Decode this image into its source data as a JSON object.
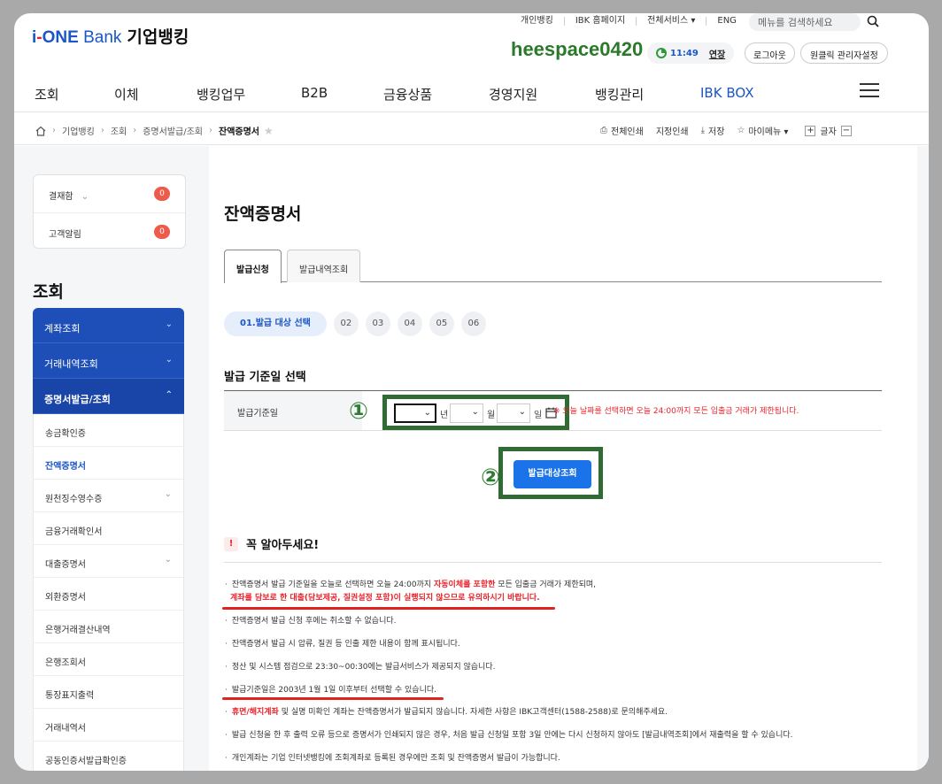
{
  "header": {
    "logo_prefix": "i",
    "logo_dash": "-",
    "logo_one": "ONE",
    "logo_bank": "Bank",
    "logo_kr": "기업뱅킹",
    "util_links": [
      "개인뱅킹",
      "IBK 홈페이지",
      "전체서비스 ▾",
      "ENG"
    ],
    "search_placeholder": "메뉴를 검색하세요",
    "watermark": "heespace0420",
    "session_time": "11:49",
    "extend_label": "연장",
    "logout_label": "로그아웃",
    "oneclick_label": "원클릭 관리자설정"
  },
  "gnb": [
    "조회",
    "이체",
    "뱅킹업무",
    "B2B",
    "금융상품",
    "경영지원",
    "뱅킹관리",
    "IBK BOX"
  ],
  "breadcrumb": [
    "기업뱅킹",
    "조회",
    "증명서발급/조회",
    "잔액증명서"
  ],
  "tools": {
    "print_all": "전체인쇄",
    "print_selected": "지정인쇄",
    "save": "저장",
    "my_menu": "마이메뉴 ▾",
    "font_label": "글자"
  },
  "sidebar": {
    "alarm": [
      {
        "label": "결재함",
        "count": "0"
      },
      {
        "label": "고객알림",
        "count": "0"
      }
    ],
    "title": "조회",
    "groups": [
      {
        "label": "계좌조회"
      },
      {
        "label": "거래내역조회"
      },
      {
        "label": "증명서발급/조회"
      }
    ],
    "subitems": [
      "송금확인증",
      "잔액증명서",
      "원천징수영수증",
      "금융거래확인서",
      "대출증명서",
      "외환증명서",
      "은행거래결산내역",
      "은행조회서",
      "통장표지출력",
      "거래내역서",
      "공동인증서발급확인증"
    ]
  },
  "main": {
    "title": "잔액증명서",
    "tabs": [
      "발급신청",
      "발급내역조회"
    ],
    "steps": [
      "01.발급 대상 선택",
      "02",
      "03",
      "04",
      "05",
      "06"
    ],
    "section_title": "발급 기준일 선택",
    "field_label": "발급기준일",
    "unit_year": "년",
    "unit_month": "월",
    "unit_day": "일",
    "warning": "※ 오늘 날짜를 선택하면 오늘 24:00까지 모든 입출금 거래가 제한됩니다.",
    "button_label": "발급대상조회",
    "marker1": "①",
    "marker2": "②",
    "notice_title": "꼭 알아두세요!",
    "notice_bang": "!",
    "notes": {
      "n1a": "잔액증명서 발급 기준일을 오늘로 선택하면 오늘 24:00까지 ",
      "n1b": "자동이체를 포함한",
      "n1c": " 모든 입출금 거래가 제한되며,",
      "n1d": "계좌를 담보로 한 대출(담보제공, 질권설정 포함)이 실행되지 않으므로 유의하시기 바랍니다.",
      "n2": "잔액증명서 발급 신청 후에는 취소할 수 없습니다.",
      "n3": "잔액증명서 발급 시 압류, 질권 등 인출 제한 내용이 함께 표시됩니다.",
      "n4": "정산 및 시스템 점검으로 23:30~00:30에는 발급서비스가 제공되지 않습니다.",
      "n5": "발급기준일은 2003년 1월 1일 이후부터 선택할 수 있습니다.",
      "n6a": "휴면/해지계좌",
      "n6b": " 및 실명 미확인 계좌는 잔액증명서가 발급되지 않습니다. 자세한 사항은 IBK고객센터(1588-2588)로 문의해주세요.",
      "n7": "발급 신청을 한 후 출력 오류 등으로 증명서가 인쇄되지 않은 경우, 처음 발급 신청일 포함 3일 안에는 다시 신청하지 않아도 [발급내역조회]에서 재출력을 할 수 있습니다.",
      "n8": "개인계좌는 기업 인터넷뱅킹에 조회계좌로 등록된 경우에만 조회 및 잔액증명서 발급이 가능합니다."
    }
  },
  "colors": {
    "brand": "#1a56c7",
    "sidebar": "#1e4fb8",
    "primary_button": "#1a73e8",
    "warning": "#e8232a",
    "annotation": "#2f6b33"
  }
}
